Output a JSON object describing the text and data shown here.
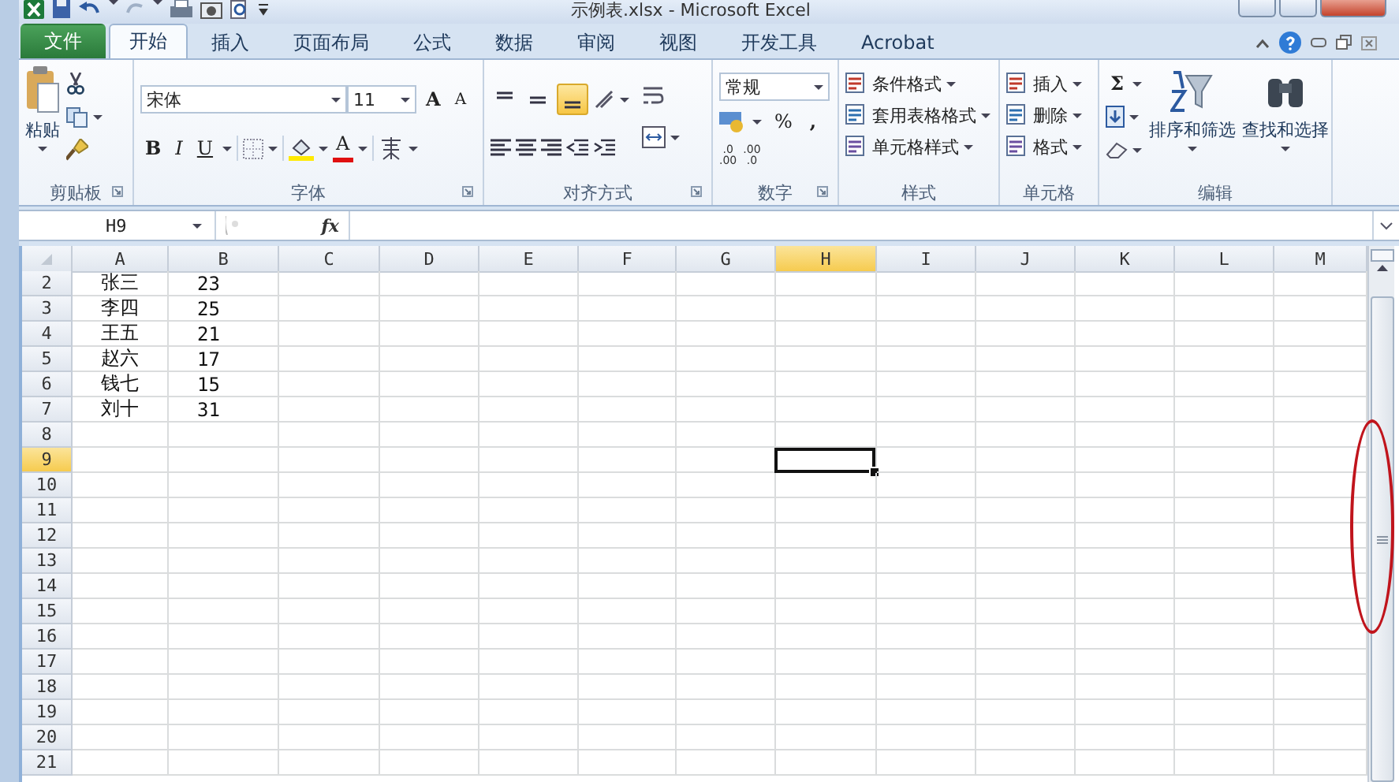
{
  "title": "示例表.xlsx - Microsoft Excel",
  "tabs": [
    {
      "label": "文件",
      "kind": "file",
      "selected": false
    },
    {
      "label": "开始",
      "kind": "tab",
      "selected": true
    },
    {
      "label": "插入",
      "kind": "tab",
      "selected": false
    },
    {
      "label": "页面布局",
      "kind": "tab",
      "selected": false
    },
    {
      "label": "公式",
      "kind": "tab",
      "selected": false
    },
    {
      "label": "数据",
      "kind": "tab",
      "selected": false
    },
    {
      "label": "审阅",
      "kind": "tab",
      "selected": false
    },
    {
      "label": "视图",
      "kind": "tab",
      "selected": false
    },
    {
      "label": "开发工具",
      "kind": "tab",
      "selected": false
    },
    {
      "label": "Acrobat",
      "kind": "tab",
      "selected": false
    }
  ],
  "ribbon": {
    "clipboard": {
      "paste": "粘贴",
      "label": "剪贴板"
    },
    "font": {
      "name": "宋体",
      "size": "11",
      "grow": "A",
      "shrink": "A",
      "bold": "B",
      "italic": "I",
      "underline": "U",
      "color_letter": "A",
      "label": "字体"
    },
    "alignment": {
      "vertical": [
        {
          "selected": false
        },
        {
          "selected": false
        },
        {
          "selected": true
        }
      ],
      "label": "对齐方式"
    },
    "number": {
      "format": "常规",
      "percent": "%",
      "comma": ",",
      "increase_decimal": [
        ".0",
        ".00"
      ],
      "decrease_decimal": [
        ".00",
        ".0"
      ],
      "label": "数字"
    },
    "styles": {
      "items": [
        "条件格式",
        "套用表格格式",
        "单元格样式"
      ],
      "label": "样式"
    },
    "cells": {
      "items": [
        "插入",
        "删除",
        "格式"
      ],
      "label": "单元格"
    },
    "editing": {
      "sum": "Σ",
      "sort": "排序和筛选",
      "find": "查找和选择",
      "label": "编辑"
    }
  },
  "formula_bar": {
    "name_box": "H9",
    "fx": "fx"
  },
  "sheet": {
    "columns": [
      {
        "label": "A",
        "selected": false
      },
      {
        "label": "B",
        "selected": false
      },
      {
        "label": "C",
        "selected": false
      },
      {
        "label": "D",
        "selected": false
      },
      {
        "label": "E",
        "selected": false
      },
      {
        "label": "F",
        "selected": false
      },
      {
        "label": "G",
        "selected": false
      },
      {
        "label": "H",
        "selected": true
      },
      {
        "label": "I",
        "selected": false
      },
      {
        "label": "J",
        "selected": false
      },
      {
        "label": "K",
        "selected": false
      },
      {
        "label": "L",
        "selected": false
      },
      {
        "label": "M",
        "selected": false
      }
    ],
    "rows": [
      {
        "number": "2",
        "selected": false,
        "cells": [
          "张三",
          "23"
        ]
      },
      {
        "number": "3",
        "selected": false,
        "cells": [
          "李四",
          "25"
        ]
      },
      {
        "number": "4",
        "selected": false,
        "cells": [
          "王五",
          "21"
        ]
      },
      {
        "number": "5",
        "selected": false,
        "cells": [
          "赵六",
          "17"
        ]
      },
      {
        "number": "6",
        "selected": false,
        "cells": [
          "钱七",
          "15"
        ]
      },
      {
        "number": "7",
        "selected": false,
        "cells": [
          "刘十",
          "31"
        ]
      },
      {
        "number": "8",
        "selected": false,
        "cells": []
      },
      {
        "number": "9",
        "selected": true,
        "cells": []
      },
      {
        "number": "10",
        "selected": false,
        "cells": []
      },
      {
        "number": "11",
        "selected": false,
        "cells": []
      },
      {
        "number": "12",
        "selected": false,
        "cells": []
      },
      {
        "number": "13",
        "selected": false,
        "cells": []
      },
      {
        "number": "14",
        "selected": false,
        "cells": []
      },
      {
        "number": "15",
        "selected": false,
        "cells": []
      },
      {
        "number": "16",
        "selected": false,
        "cells": []
      },
      {
        "number": "17",
        "selected": false,
        "cells": []
      },
      {
        "number": "18",
        "selected": false,
        "cells": []
      },
      {
        "number": "19",
        "selected": false,
        "cells": []
      },
      {
        "number": "20",
        "selected": false,
        "cells": []
      },
      {
        "number": "21",
        "selected": false,
        "cells": []
      }
    ]
  }
}
